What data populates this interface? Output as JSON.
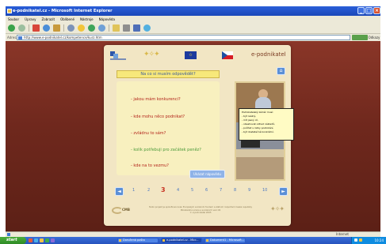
{
  "window": {
    "title": "e-podnikatel.cz - Microsoft Internet Explorer",
    "controls": [
      "_",
      "□",
      "×"
    ]
  },
  "menu": [
    "Soubor",
    "Úpravy",
    "Zobrazit",
    "Oblíbené",
    "Nástroje",
    "Nápověda"
  ],
  "toolbar": {
    "icons": [
      "back-icon",
      "forward-icon",
      "stop-icon",
      "refresh-icon",
      "home-icon",
      "search-icon",
      "favorites-icon",
      "media-icon",
      "history-icon",
      "mail-icon",
      "print-icon",
      "edit-icon",
      "messenger-icon"
    ]
  },
  "address": {
    "label": "Adresa",
    "url": "http://www.e-podnikatel.cz/kompetence/kurz.htm",
    "links": "Odkazy"
  },
  "page": {
    "brand": "e-podnikatel",
    "question": "Na co si musím odpovědět?",
    "options": [
      "- jakou mám konkurenci?",
      "- kde mohu něco podnikat?",
      "- zvládnu to sám?",
      "- kolik potřebuji pro začátek peněz?",
      "- kde na to vezmu?"
    ],
    "help_button": "Ukázat nápovědu",
    "tooltip_lines": [
      "Podnikatelský záměr musí:",
      "- být reálný,",
      "- mít jasný cíl,",
      "- obsahovat odhad nákladů,",
      "- počítat s riziky podnikání,",
      "- být dostatečně konkrétní."
    ],
    "pagination": {
      "prev": "◄",
      "next": "►",
      "pages": [
        "1",
        "2",
        "3",
        "4",
        "5",
        "6",
        "7",
        "8",
        "9",
        "10"
      ],
      "current": "3"
    },
    "footer_logo": "CMB",
    "footer_lines": [
      "Tento projekt je spolufinancován Evropským sociálním fondem a státním rozpočtem České republiky",
      "Ministerstvo práce a sociálních věcí ČR",
      "© e-podnikatel 2005"
    ]
  },
  "status": {
    "left": "",
    "zone": "Internet"
  },
  "taskbar": {
    "start": "start",
    "tasks": [
      "Doručená pošta",
      "e-podnikatel.cz - Micr...",
      "Dokument1 - Microsoft..."
    ],
    "clock": "10:24"
  }
}
